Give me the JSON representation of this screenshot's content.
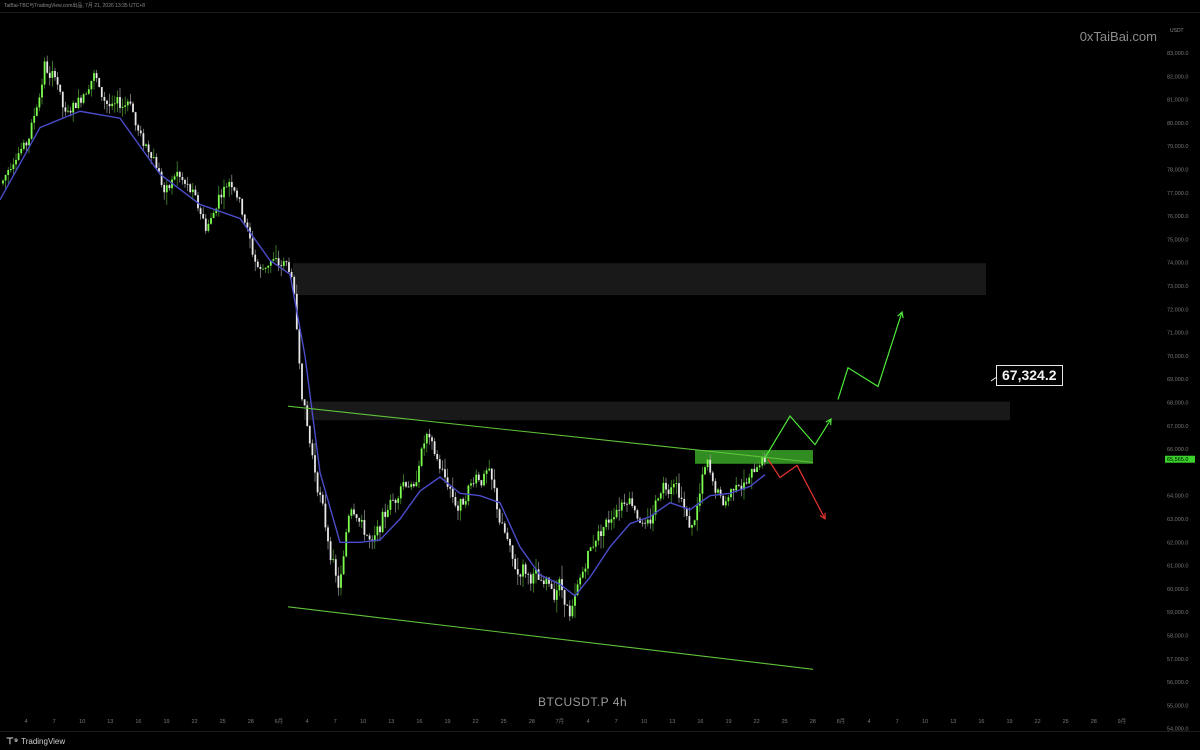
{
  "header": {
    "caption": "TaiBai-TBC与TradingView.com出品, 7月 21, 2026 13:35 UTC+8"
  },
  "watermark": "0xTaiBai.com",
  "symbol": "BTCUSDT.P   4h",
  "footer_brand": "TradingView",
  "callout": "67,324.2",
  "chart_data": {
    "type": "candlestick",
    "currency": "USDT",
    "ylim": [
      53200,
      83600
    ],
    "y_ticks": [
      "83,000.0",
      "82,000.0",
      "81,000.0",
      "80,000.0",
      "79,000.0",
      "78,000.0",
      "77,000.0",
      "76,000.0",
      "75,000.0",
      "74,000.0",
      "73,000.0",
      "72,000.0",
      "71,000.0",
      "70,000.0",
      "69,000.0",
      "68,000.0",
      "67,000.0",
      "66,000.0",
      "64,000.0",
      "63,000.0",
      "62,000.0",
      "61,000.0",
      "60,000.0",
      "59,000.0",
      "58,000.0",
      "57,000.0",
      "56,000.0",
      "55,000.0",
      "54,000.0"
    ],
    "current_price": "65,565.0",
    "x_ticks": [
      "4",
      "7",
      "10",
      "13",
      "16",
      "19",
      "22",
      "25",
      "28",
      "6月",
      "4",
      "7",
      "10",
      "13",
      "16",
      "19",
      "22",
      "25",
      "28",
      "7月",
      "4",
      "7",
      "10",
      "13",
      "16",
      "19",
      "22",
      "25",
      "28",
      "8月",
      "4",
      "7",
      "10",
      "13",
      "16",
      "19",
      "22",
      "25",
      "28",
      "9月"
    ],
    "price_path": [
      [
        0,
        77200
      ],
      [
        10,
        78200
      ],
      [
        20,
        78800
      ],
      [
        28,
        79200
      ],
      [
        35,
        80500
      ],
      [
        40,
        81200
      ],
      [
        45,
        82600
      ],
      [
        50,
        81800
      ],
      [
        55,
        82200
      ],
      [
        60,
        81200
      ],
      [
        65,
        80300
      ],
      [
        72,
        80600
      ],
      [
        80,
        81000
      ],
      [
        88,
        81600
      ],
      [
        95,
        82100
      ],
      [
        100,
        81300
      ],
      [
        106,
        80900
      ],
      [
        112,
        80600
      ],
      [
        118,
        80900
      ],
      [
        124,
        80700
      ],
      [
        130,
        81100
      ],
      [
        136,
        79800
      ],
      [
        142,
        79300
      ],
      [
        148,
        78900
      ],
      [
        154,
        78500
      ],
      [
        160,
        77700
      ],
      [
        165,
        76900
      ],
      [
        170,
        77300
      ],
      [
        176,
        77900
      ],
      [
        182,
        77500
      ],
      [
        188,
        77200
      ],
      [
        194,
        76900
      ],
      [
        200,
        76200
      ],
      [
        206,
        75500
      ],
      [
        212,
        75900
      ],
      [
        218,
        76800
      ],
      [
        224,
        77100
      ],
      [
        230,
        77600
      ],
      [
        236,
        77000
      ],
      [
        242,
        76200
      ],
      [
        248,
        75300
      ],
      [
        254,
        74200
      ],
      [
        260,
        73600
      ],
      [
        266,
        73900
      ],
      [
        272,
        74100
      ],
      [
        280,
        73900
      ],
      [
        286,
        74000
      ],
      [
        290,
        73700
      ],
      [
        294,
        72600
      ],
      [
        298,
        70600
      ],
      [
        302,
        68400
      ],
      [
        306,
        67300
      ],
      [
        310,
        66200
      ],
      [
        314,
        65400
      ],
      [
        318,
        64300
      ],
      [
        322,
        63600
      ],
      [
        326,
        62600
      ],
      [
        330,
        61700
      ],
      [
        334,
        60800
      ],
      [
        338,
        60100
      ],
      [
        342,
        60600
      ],
      [
        346,
        62400
      ],
      [
        350,
        63600
      ],
      [
        355,
        63300
      ],
      [
        360,
        62800
      ],
      [
        366,
        62400
      ],
      [
        372,
        61800
      ],
      [
        378,
        62600
      ],
      [
        384,
        63100
      ],
      [
        390,
        63700
      ],
      [
        396,
        63900
      ],
      [
        402,
        64600
      ],
      [
        408,
        64500
      ],
      [
        414,
        64200
      ],
      [
        418,
        65300
      ],
      [
        422,
        65900
      ],
      [
        426,
        66600
      ],
      [
        430,
        66300
      ],
      [
        434,
        65900
      ],
      [
        440,
        65200
      ],
      [
        446,
        64700
      ],
      [
        452,
        64100
      ],
      [
        458,
        63400
      ],
      [
        464,
        63900
      ],
      [
        470,
        64400
      ],
      [
        476,
        64900
      ],
      [
        482,
        64600
      ],
      [
        488,
        65100
      ],
      [
        494,
        64300
      ],
      [
        500,
        62800
      ],
      [
        506,
        62300
      ],
      [
        512,
        61300
      ],
      [
        518,
        60600
      ],
      [
        524,
        60900
      ],
      [
        530,
        60400
      ],
      [
        536,
        60600
      ],
      [
        542,
        60100
      ],
      [
        548,
        60400
      ],
      [
        554,
        59800
      ],
      [
        560,
        60300
      ],
      [
        566,
        59400
      ],
      [
        570,
        58700
      ],
      [
        574,
        59400
      ],
      [
        578,
        60200
      ],
      [
        584,
        60900
      ],
      [
        590,
        61700
      ],
      [
        596,
        62200
      ],
      [
        602,
        62600
      ],
      [
        608,
        62900
      ],
      [
        614,
        63300
      ],
      [
        620,
        63600
      ],
      [
        626,
        63900
      ],
      [
        632,
        63700
      ],
      [
        638,
        63100
      ],
      [
        644,
        62600
      ],
      [
        650,
        62900
      ],
      [
        656,
        63700
      ],
      [
        662,
        64500
      ],
      [
        668,
        64300
      ],
      [
        674,
        64700
      ],
      [
        680,
        64100
      ],
      [
        686,
        63100
      ],
      [
        692,
        62600
      ],
      [
        698,
        63600
      ],
      [
        704,
        65100
      ],
      [
        708,
        65400
      ],
      [
        712,
        64600
      ],
      [
        718,
        64100
      ],
      [
        724,
        63600
      ],
      [
        730,
        64100
      ],
      [
        736,
        64700
      ],
      [
        742,
        64300
      ],
      [
        748,
        64600
      ],
      [
        754,
        65100
      ],
      [
        760,
        65500
      ],
      [
        765,
        65560
      ]
    ],
    "ma_path": [
      [
        0,
        76700
      ],
      [
        40,
        79800
      ],
      [
        80,
        80500
      ],
      [
        120,
        80200
      ],
      [
        160,
        77800
      ],
      [
        200,
        76500
      ],
      [
        240,
        75900
      ],
      [
        270,
        74100
      ],
      [
        290,
        73500
      ],
      [
        305,
        70000
      ],
      [
        320,
        65000
      ],
      [
        340,
        62000
      ],
      [
        360,
        62000
      ],
      [
        380,
        62100
      ],
      [
        400,
        63000
      ],
      [
        420,
        64200
      ],
      [
        440,
        64800
      ],
      [
        460,
        64100
      ],
      [
        480,
        64000
      ],
      [
        500,
        63700
      ],
      [
        520,
        61800
      ],
      [
        540,
        60600
      ],
      [
        560,
        60200
      ],
      [
        575,
        59700
      ],
      [
        590,
        60500
      ],
      [
        610,
        61800
      ],
      [
        630,
        62800
      ],
      [
        650,
        63100
      ],
      [
        670,
        63700
      ],
      [
        690,
        63400
      ],
      [
        710,
        64000
      ],
      [
        730,
        64100
      ],
      [
        750,
        64400
      ],
      [
        765,
        64900
      ]
    ],
    "channel_upper": [
      [
        288,
        67840
      ],
      [
        813,
        65430
      ]
    ],
    "channel_lower": [
      [
        288,
        59230
      ],
      [
        813,
        56550
      ]
    ],
    "zones": [
      {
        "from_x": 293,
        "to_x": 986,
        "y_top": 73980,
        "y_bottom": 72610
      },
      {
        "from_x": 304,
        "to_x": 1010,
        "y_top": 68040,
        "y_bottom": 67240
      },
      {
        "from_x": 695,
        "to_x": 813,
        "y_top": 65960,
        "y_bottom": 65370
      }
    ],
    "bull_projection": [
      [
        765,
        65630
      ],
      [
        790,
        67420
      ],
      [
        815,
        66190
      ],
      [
        831,
        67290
      ]
    ],
    "bull_projection_2": [
      [
        838,
        68130
      ],
      [
        848,
        69490
      ],
      [
        878,
        68690
      ],
      [
        902,
        71880
      ]
    ],
    "bear_projection": [
      [
        768,
        65570
      ],
      [
        780,
        64780
      ],
      [
        797,
        65300
      ],
      [
        825,
        63010
      ]
    ]
  }
}
